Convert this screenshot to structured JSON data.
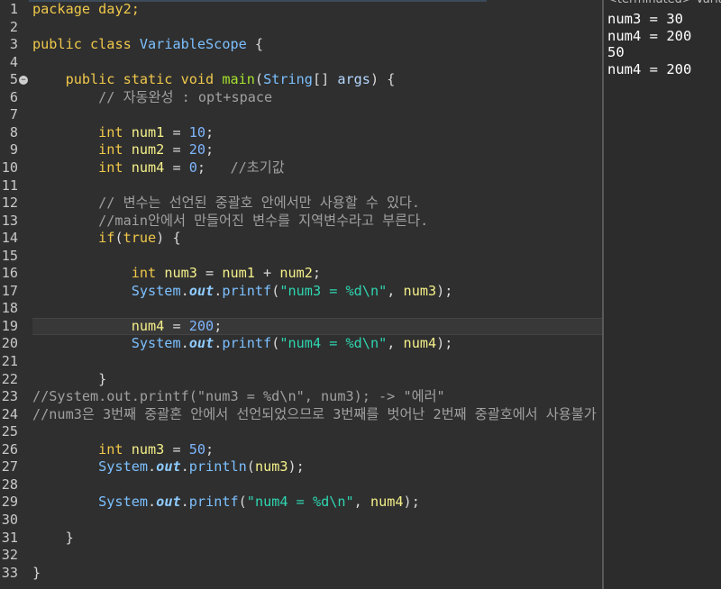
{
  "editor": {
    "line_numbers": [
      "1",
      "2",
      "3",
      "4",
      "5",
      "6",
      "7",
      "8",
      "9",
      "10",
      "11",
      "12",
      "13",
      "14",
      "15",
      "16",
      "17",
      "18",
      "19",
      "20",
      "21",
      "22",
      "23",
      "24",
      "25",
      "26",
      "27",
      "28",
      "29",
      "30",
      "31",
      "32",
      "33"
    ],
    "lines": [
      [
        {
          "t": "package ",
          "c": "kw"
        },
        {
          "t": "day2;",
          "c": "kw"
        }
      ],
      [],
      [
        {
          "t": "public ",
          "c": "kw"
        },
        {
          "t": "class ",
          "c": "kw"
        },
        {
          "t": "VariableScope",
          "c": "cls"
        },
        {
          "t": " {",
          "c": "pln"
        }
      ],
      [],
      [
        {
          "t": "    public ",
          "c": "kw"
        },
        {
          "t": "static ",
          "c": "kw"
        },
        {
          "t": "void ",
          "c": "kw"
        },
        {
          "t": "main",
          "c": "mth"
        },
        {
          "t": "(",
          "c": "pln"
        },
        {
          "t": "String",
          "c": "cls"
        },
        {
          "t": "[] ",
          "c": "pln"
        },
        {
          "t": "args",
          "c": "prm"
        },
        {
          "t": ") {",
          "c": "pln"
        }
      ],
      [
        {
          "t": "        // 자동완성 : opt+space",
          "c": "cmt"
        }
      ],
      [],
      [
        {
          "t": "        int ",
          "c": "kw"
        },
        {
          "t": "num1",
          "c": "var"
        },
        {
          "t": " = ",
          "c": "pln"
        },
        {
          "t": "10",
          "c": "num"
        },
        {
          "t": ";",
          "c": "pln"
        }
      ],
      [
        {
          "t": "        int ",
          "c": "kw"
        },
        {
          "t": "num2",
          "c": "var"
        },
        {
          "t": " = ",
          "c": "pln"
        },
        {
          "t": "20",
          "c": "num"
        },
        {
          "t": ";",
          "c": "pln"
        }
      ],
      [
        {
          "t": "        int ",
          "c": "kw"
        },
        {
          "t": "num4",
          "c": "var"
        },
        {
          "t": " = ",
          "c": "pln"
        },
        {
          "t": "0",
          "c": "num"
        },
        {
          "t": ";   ",
          "c": "pln"
        },
        {
          "t": "//초기값",
          "c": "cmt"
        }
      ],
      [],
      [
        {
          "t": "        // 변수는 선언된 중괄호 안에서만 사용할 수 있다.",
          "c": "cmt"
        }
      ],
      [
        {
          "t": "        //main안에서 만들어진 변수를 지역변수라고 부른다.",
          "c": "cmt"
        }
      ],
      [
        {
          "t": "        if",
          "c": "kw"
        },
        {
          "t": "(",
          "c": "pln"
        },
        {
          "t": "true",
          "c": "kw"
        },
        {
          "t": ") {",
          "c": "pln"
        }
      ],
      [],
      [
        {
          "t": "            int ",
          "c": "kw"
        },
        {
          "t": "num3",
          "c": "var"
        },
        {
          "t": " = ",
          "c": "pln"
        },
        {
          "t": "num1",
          "c": "var"
        },
        {
          "t": " + ",
          "c": "pln"
        },
        {
          "t": "num2",
          "c": "var"
        },
        {
          "t": ";",
          "c": "pln"
        }
      ],
      [
        {
          "t": "            System",
          "c": "cls"
        },
        {
          "t": ".",
          "c": "pln"
        },
        {
          "t": "out",
          "c": "fld"
        },
        {
          "t": ".",
          "c": "pln"
        },
        {
          "t": "printf",
          "c": "cls"
        },
        {
          "t": "(",
          "c": "pln"
        },
        {
          "t": "\"num3 = %d\\n\"",
          "c": "str"
        },
        {
          "t": ", ",
          "c": "pln"
        },
        {
          "t": "num3",
          "c": "var"
        },
        {
          "t": ");",
          "c": "pln"
        }
      ],
      [],
      [
        {
          "t": "            num4",
          "c": "var"
        },
        {
          "t": " = ",
          "c": "pln"
        },
        {
          "t": "200",
          "c": "num"
        },
        {
          "t": ";",
          "c": "pln"
        }
      ],
      [
        {
          "t": "            System",
          "c": "cls"
        },
        {
          "t": ".",
          "c": "pln"
        },
        {
          "t": "out",
          "c": "fld"
        },
        {
          "t": ".",
          "c": "pln"
        },
        {
          "t": "printf",
          "c": "cls"
        },
        {
          "t": "(",
          "c": "pln"
        },
        {
          "t": "\"num4 = %d\\n\"",
          "c": "str"
        },
        {
          "t": ", ",
          "c": "pln"
        },
        {
          "t": "num4",
          "c": "var"
        },
        {
          "t": ");",
          "c": "pln"
        }
      ],
      [],
      [
        {
          "t": "        }",
          "c": "pln"
        }
      ],
      [
        {
          "t": "//System.out.printf(\"num3 = %d\\n\", num3); -> \"에러\"",
          "c": "cmt"
        }
      ],
      [
        {
          "t": "//num3은 3번째 중괄혼 안에서 선언되었으므로 3번째를 벗어난 2번째 중괄호에서 사용불가",
          "c": "cmt"
        }
      ],
      [],
      [
        {
          "t": "        int ",
          "c": "kw"
        },
        {
          "t": "num3",
          "c": "var"
        },
        {
          "t": " = ",
          "c": "pln"
        },
        {
          "t": "50",
          "c": "num"
        },
        {
          "t": ";",
          "c": "pln"
        }
      ],
      [
        {
          "t": "        System",
          "c": "cls"
        },
        {
          "t": ".",
          "c": "pln"
        },
        {
          "t": "out",
          "c": "fld"
        },
        {
          "t": ".",
          "c": "pln"
        },
        {
          "t": "println",
          "c": "cls"
        },
        {
          "t": "(",
          "c": "pln"
        },
        {
          "t": "num3",
          "c": "var"
        },
        {
          "t": ");",
          "c": "pln"
        }
      ],
      [],
      [
        {
          "t": "        System",
          "c": "cls"
        },
        {
          "t": ".",
          "c": "pln"
        },
        {
          "t": "out",
          "c": "fld"
        },
        {
          "t": ".",
          "c": "pln"
        },
        {
          "t": "printf",
          "c": "cls"
        },
        {
          "t": "(",
          "c": "pln"
        },
        {
          "t": "\"num4 = %d\\n\"",
          "c": "str"
        },
        {
          "t": ", ",
          "c": "pln"
        },
        {
          "t": "num4",
          "c": "var"
        },
        {
          "t": ");",
          "c": "pln"
        }
      ],
      [],
      [
        {
          "t": "    }",
          "c": "pln"
        }
      ],
      [],
      [
        {
          "t": "}",
          "c": "pln"
        }
      ]
    ],
    "fold_marker_line": "5",
    "highlighted_line": "19"
  },
  "console": {
    "header": "<terminated> Varia",
    "output": [
      "num3 = 30",
      "num4 = 200",
      "50",
      "num4 = 200"
    ]
  },
  "colors": {
    "keyword": "#f0c84a",
    "type": "#7cc0ff",
    "method": "#a6e22e",
    "variable": "#f5f08a",
    "number": "#7fb6ff",
    "string": "#2fd5b0",
    "comment": "#a0a0a0",
    "background": "#2f2f2f"
  }
}
